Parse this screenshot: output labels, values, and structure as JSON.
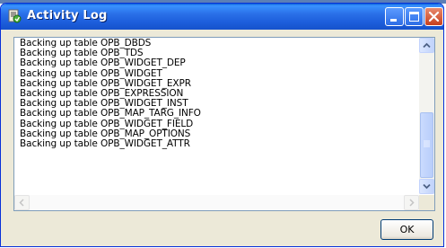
{
  "window": {
    "title": "Activity Log",
    "icon": "activity-log-app-icon"
  },
  "titlebar_buttons": {
    "minimize_icon": "minimize-icon",
    "maximize_icon": "maximize-icon",
    "close_icon": "close-icon"
  },
  "log": {
    "lines": [
      "Backing up table OPB_DBDS",
      "Backing up table OPB_TDS",
      "Backing up table OPB_WIDGET_DEP",
      "Backing up table OPB_WIDGET",
      "Backing up table OPB_WIDGET_EXPR",
      "Backing up table OPB_EXPRESSION",
      "Backing up table OPB_WIDGET_INST",
      "Backing up table OPB_MAP_TARG_INFO",
      "Backing up table OPB_WIDGET_FIELD",
      "Backing up table OPB_MAP_OPTIONS",
      "Backing up table OPB_WIDGET_ATTR"
    ]
  },
  "footer": {
    "ok_label": "OK"
  },
  "colors": {
    "titlebar": "#1d5fdc",
    "window_bg": "#ece9d8",
    "close_button": "#c8401e"
  }
}
